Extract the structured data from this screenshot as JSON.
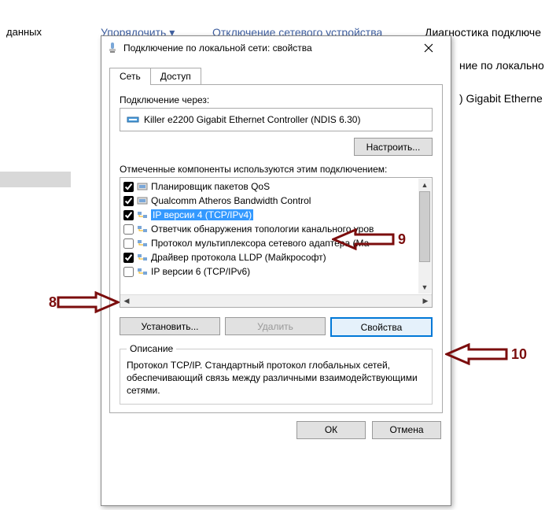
{
  "background": {
    "text1": "данных",
    "menu1": "Упорядочить ▾",
    "menu2": "Отключение сетевого устройства",
    "menu3": "Диагностика подключе",
    "line1": "ние по локально",
    "line2": ") Gigabit Etherne"
  },
  "window": {
    "title": "Подключение по локальной сети: свойства",
    "tabs": {
      "network": "Сеть",
      "access": "Доступ"
    },
    "connect_label": "Подключение через:",
    "adapter_name": "Killer e2200 Gigabit Ethernet Controller (NDIS 6.30)",
    "configure_btn": "Настроить...",
    "components_label": "Отмеченные компоненты используются этим подключением:",
    "items": [
      {
        "checked": true,
        "label": "Планировщик пакетов QoS"
      },
      {
        "checked": true,
        "label": "Qualcomm Atheros Bandwidth Control"
      },
      {
        "checked": true,
        "label": "IP версии 4 (TCP/IPv4)"
      },
      {
        "checked": false,
        "label": "Ответчик обнаружения топологии канального уров"
      },
      {
        "checked": false,
        "label": "Протокол мультиплексора сетевого адаптера (Ма"
      },
      {
        "checked": true,
        "label": "Драйвер протокола LLDP (Майкрософт)"
      },
      {
        "checked": false,
        "label": "IP версии 6 (TCP/IPv6)"
      }
    ],
    "install_btn": "Установить...",
    "remove_btn": "Удалить",
    "props_btn": "Свойства",
    "desc_legend": "Описание",
    "desc_text": "Протокол TCP/IP. Стандартный протокол глобальных сетей, обеспечивающий связь между различными взаимодействующими сетями.",
    "ok_btn": "ОК",
    "cancel_btn": "Отмена"
  },
  "annotations": {
    "n8": "8",
    "n9": "9",
    "n10": "10"
  }
}
